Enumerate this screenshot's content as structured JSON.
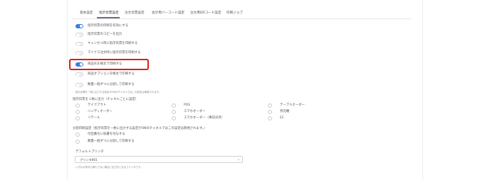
{
  "tabs": [
    {
      "label": "基本設定"
    },
    {
      "label": "指示伝票設定",
      "active": true
    },
    {
      "label": "注文伝票設定"
    },
    {
      "label": "会計用バーコード設定"
    },
    {
      "label": "注文用QRコード設定"
    },
    {
      "label": "印刷ジョブ"
    }
  ],
  "toggles": [
    {
      "label": "指示伝票の印刷を有効にする",
      "state": "on"
    },
    {
      "label": "指示伝票のコピーを出力",
      "state": "off"
    },
    {
      "label": "キャンセル時に指示伝票を印刷する",
      "state": "off"
    },
    {
      "label": "マイナス注文時に指示伝票を印刷する",
      "state": "off"
    },
    {
      "label": "商品名を極太で印刷する",
      "state": "on"
    },
    {
      "label": "商品オプションを極太で印刷する",
      "state": "off"
    },
    {
      "label": "数量一個ずつに分割して印刷する",
      "state": "off"
    }
  ],
  "split_note": "指示伝票を一個に出力する設定がONのチャネルではこの設定は無視されます。",
  "channels": {
    "title": "指示伝票を１枚に出力（チャネルごとに設定）",
    "col1": [
      "テイクアウト",
      "ハンディオーダー",
      "リテール"
    ],
    "col2": [
      "POS",
      "スマホオーダー",
      "スマホオーダー（事前決済）"
    ],
    "col3": [
      "テーブルオーダー",
      "券売機",
      "EC"
    ]
  },
  "combined": {
    "title": "分割印刷設定（指示伝票を一枚に出力する設定がONのチャネルではこの設定は無視されます。）",
    "options": [
      "付出番号に枝番を付与する",
      "数量一個ずつに分割して印刷する"
    ]
  },
  "printer": {
    "label": "デフォルトプリンタ",
    "value": "プリンタ001",
    "note": "いずれの条件も満たさない場合に出力先となるプリンタです。"
  },
  "colors": {
    "accent": "#3b7de0",
    "highlight": "#d91e1e"
  }
}
